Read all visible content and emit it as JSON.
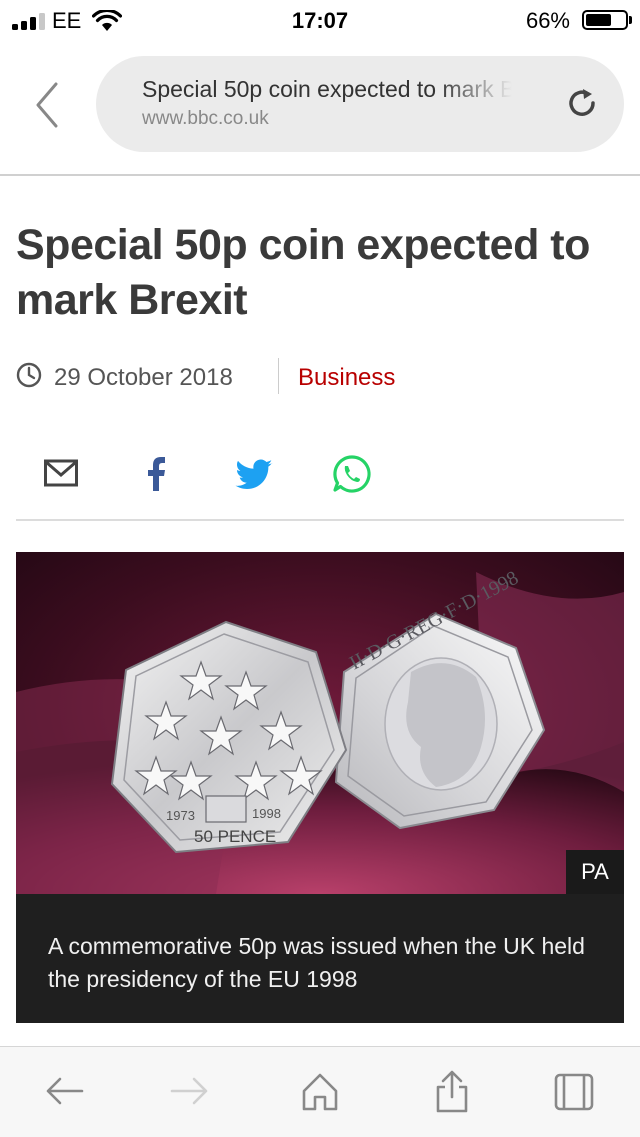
{
  "status_bar": {
    "carrier": "EE",
    "time": "17:07",
    "battery_percent": "66%",
    "battery_level": 0.66,
    "signal_bars_active": 3,
    "signal_bars_total": 4
  },
  "browser": {
    "page_title": "Special 50p coin expected to mark Brexit",
    "domain": "www.bbc.co.uk"
  },
  "article": {
    "headline": "Special 50p coin expected to mark Brexit",
    "date": "29 October 2018",
    "section": "Business",
    "share_icons": [
      "mail-icon",
      "facebook-icon",
      "twitter-icon",
      "whatsapp-icon"
    ],
    "image": {
      "credit": "PA",
      "caption": "A commemorative 50p was issued when the UK held the presidency of the EU 1998",
      "coin_left_text": "50 PENCE",
      "coin_left_years": [
        "1973",
        "1998"
      ],
      "coin_right_text": "II·D·G·REG·F·D·1998"
    }
  },
  "toolbar": {
    "icons": [
      "back-arrow-icon",
      "forward-arrow-icon",
      "home-icon",
      "share-icon",
      "tabs-icon"
    ]
  },
  "colors": {
    "headline": "#3a3a3a",
    "section": "#b80000",
    "facebook": "#3b5998",
    "twitter": "#1da1f2",
    "whatsapp": "#25d366",
    "caption_bg": "#1f1f1f",
    "url_bar_bg": "#ebebeb"
  }
}
